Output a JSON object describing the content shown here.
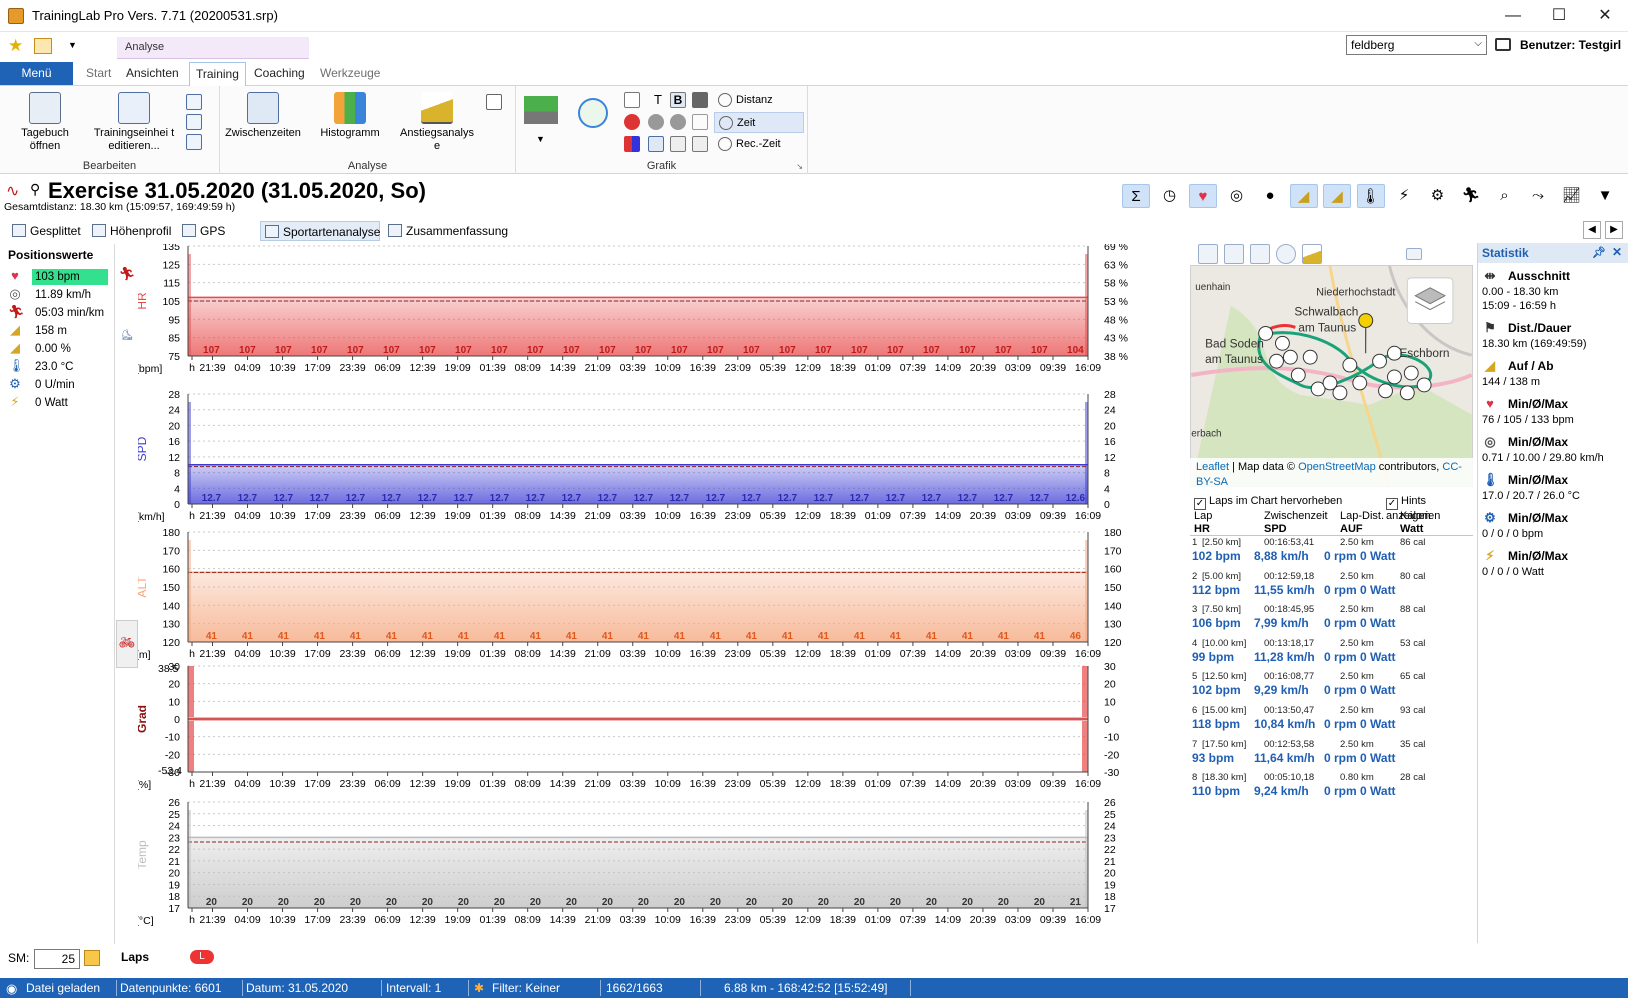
{
  "window": {
    "title": "TrainingLab Pro Vers. 7.71 (20200531.srp)",
    "min": "—",
    "max": "☐",
    "close": "✕"
  },
  "context_tab": "Analyse",
  "user": {
    "selected": "feldberg",
    "label": "Benutzer: Testgirl"
  },
  "tabs": [
    "Menü",
    "Start",
    "Ansichten",
    "Training",
    "Coaching",
    "Werkzeuge"
  ],
  "ribbon": {
    "bearbeiten": {
      "label": "Bearbeiten",
      "tagebuch": "Tagebuch öffnen",
      "trainingseinheit": "Trainingseinhei t editieren..."
    },
    "analyse": {
      "label": "Analyse",
      "zwischenzeiten": "Zwischenzeiten",
      "histogramm": "Histogramm",
      "anstieg": "Anstiegsanalys e"
    },
    "grafik": {
      "label": "Grafik",
      "distanz": "Distanz",
      "zeit": "Zeit",
      "reczeit": "Rec.-Zeit",
      "t_glyph": "T",
      "b_glyph": "B"
    }
  },
  "exercise": {
    "title": "Exercise 31.05.2020 (31.05.2020, So)",
    "subtitle": "Gesamtdistanz: 18.30 km (15:09:57, 169:49:59 h)"
  },
  "view_tabs": [
    "Gesplittet",
    "Höhenprofil",
    "GPS Karte",
    "Sportartenanalyse",
    "Zusammenfassung"
  ],
  "position_values": {
    "header": "Positionswerte",
    "items": [
      {
        "icon": "heart-icon",
        "text": "103 bpm"
      },
      {
        "icon": "speedometer-icon",
        "text": "11.89 km/h"
      },
      {
        "icon": "runner-icon",
        "text": "05:03 min/km"
      },
      {
        "icon": "mountain-icon",
        "text": "158 m"
      },
      {
        "icon": "slope-icon",
        "text": "0.00 %"
      },
      {
        "icon": "thermometer-icon",
        "text": "23.0 °C"
      },
      {
        "icon": "cadence-icon",
        "text": "0 U/min"
      },
      {
        "icon": "power-icon",
        "text": "0 Watt"
      }
    ]
  },
  "sm": {
    "label": "SM:",
    "value": "25"
  },
  "laps_label": "Laps",
  "x_ticks": [
    "h",
    "21:39",
    "04:09",
    "10:39",
    "17:09",
    "23:39",
    "06:09",
    "12:39",
    "19:09",
    "01:39",
    "08:09",
    "14:39",
    "21:09",
    "03:39",
    "10:09",
    "16:39",
    "23:09",
    "05:39",
    "12:09",
    "18:39",
    "01:09",
    "07:39",
    "14:09",
    "20:39",
    "03:09",
    "09:39",
    "16:09"
  ],
  "chart_data": [
    {
      "type": "area",
      "name": "HR",
      "ylabel": "HR",
      "unit": "[bpm]",
      "color": "#e84a4a",
      "y_ticks": [
        135,
        125,
        115,
        105,
        95,
        85,
        75
      ],
      "ylim": [
        75,
        135
      ],
      "right_ticks": [
        "69 %",
        "63 %",
        "58 %",
        "53 %",
        "48 %",
        "43 %",
        "38 %"
      ],
      "labels": [
        "107",
        "107",
        "107",
        "107",
        "107",
        "107",
        "107",
        "107",
        "107",
        "107",
        "107",
        "107",
        "107",
        "107",
        "107",
        "107",
        "107",
        "107",
        "107",
        "107",
        "107",
        "107",
        "107",
        "107",
        "104"
      ],
      "value": 107,
      "avg": 105
    },
    {
      "type": "area",
      "name": "SPD",
      "ylabel": "SPD",
      "unit": "[km/h]",
      "color": "#3b3bd6",
      "y_ticks": [
        28,
        24,
        20,
        16,
        12,
        8,
        4,
        0
      ],
      "ylim": [
        0,
        28
      ],
      "right_ticks": [
        "28",
        "24",
        "20",
        "16",
        "12",
        "8",
        "4",
        "0"
      ],
      "labels": [
        "12.7",
        "12.7",
        "12.7",
        "12.7",
        "12.7",
        "12.7",
        "12.7",
        "12.7",
        "12.7",
        "12.7",
        "12.7",
        "12.7",
        "12.7",
        "12.7",
        "12.7",
        "12.7",
        "12.7",
        "12.7",
        "12.7",
        "12.7",
        "12.7",
        "12.7",
        "12.7",
        "12.7",
        "12.6"
      ],
      "value": 10,
      "avg": 9.5
    },
    {
      "type": "area",
      "name": "ALT",
      "ylabel": "ALT",
      "unit": "[m]",
      "color": "#f5a47a",
      "y_ticks": [
        180,
        170,
        160,
        150,
        140,
        130,
        120
      ],
      "ylim": [
        120,
        180
      ],
      "right_ticks": [
        "180",
        "170",
        "160",
        "150",
        "140",
        "130",
        "120"
      ],
      "labels": [
        "41",
        "41",
        "41",
        "41",
        "41",
        "41",
        "41",
        "41",
        "41",
        "41",
        "41",
        "41",
        "41",
        "41",
        "41",
        "41",
        "41",
        "41",
        "41",
        "41",
        "41",
        "41",
        "41",
        "41",
        "46"
      ],
      "value": 158,
      "avg": 158
    },
    {
      "type": "line",
      "name": "Grad",
      "ylabel": "Grad",
      "unit": "[%]",
      "color": "#c21a1a",
      "y_ticks": [
        30,
        20,
        10,
        0,
        -10,
        -20,
        -30
      ],
      "ylim": [
        -30,
        30
      ],
      "right_ticks": [
        "30",
        "20",
        "10",
        "0",
        "-10",
        "-20",
        "-30"
      ],
      "extra_top": "38.5",
      "extra_bottom": "-52.4",
      "labels": [],
      "value": 0,
      "avg": 0
    },
    {
      "type": "area",
      "name": "Temp",
      "ylabel": "Temp",
      "unit": "[°C]",
      "color": "#bdbdbd",
      "y_ticks": [
        26,
        25,
        24,
        23,
        22,
        21,
        20,
        19,
        18,
        17
      ],
      "ylim": [
        17,
        26
      ],
      "right_ticks": [
        "26",
        "25",
        "24",
        "23",
        "22",
        "21",
        "20",
        "19",
        "18",
        "17"
      ],
      "labels": [
        "20",
        "20",
        "20",
        "20",
        "20",
        "20",
        "20",
        "20",
        "20",
        "20",
        "20",
        "20",
        "20",
        "20",
        "20",
        "20",
        "20",
        "20",
        "20",
        "20",
        "20",
        "20",
        "20",
        "20",
        "21"
      ],
      "value": 23,
      "avg": 22.6
    }
  ],
  "map": {
    "labels": [
      "uenhain",
      "Niederhochstadt",
      "Schwalbach am Taunus",
      "Bad Soden am Taunus",
      "Eschborn",
      "erbach"
    ],
    "attribution": {
      "leaflet": "Leaflet",
      "mid": " | Map data © ",
      "osm": "OpenStreetMap",
      "end": " contributors, ",
      "cc": "CC-BY-SA"
    }
  },
  "checks": {
    "laps": "Laps im Chart hervorheben",
    "hints": "Hints anzeigen"
  },
  "laps_table": {
    "headers": [
      [
        "Lap",
        "HR"
      ],
      [
        "Zwischenzeit",
        "SPD"
      ],
      [
        "Lap-Dist.",
        "AUF"
      ],
      [
        "Kalorien",
        "Watt"
      ]
    ],
    "rows": [
      {
        "lap": "1",
        "km": "[2.50 km]",
        "zeit": "00:16:53,41",
        "dist": "2.50 km",
        "cal": "86 cal",
        "hr": "102 bpm",
        "spd": "8,88 km/h",
        "auf": "0 rpm",
        "watt": "0 Watt"
      },
      {
        "lap": "2",
        "km": "[5.00 km]",
        "zeit": "00:12:59,18",
        "dist": "2.50 km",
        "cal": "80 cal",
        "hr": "112 bpm",
        "spd": "11,55 km/h",
        "auf": "0 rpm",
        "watt": "0 Watt"
      },
      {
        "lap": "3",
        "km": "[7.50 km]",
        "zeit": "00:18:45,95",
        "dist": "2.50 km",
        "cal": "88 cal",
        "hr": "106 bpm",
        "spd": "7,99 km/h",
        "auf": "0 rpm",
        "watt": "0 Watt"
      },
      {
        "lap": "4",
        "km": "[10.00 km]",
        "zeit": "00:13:18,17",
        "dist": "2.50 km",
        "cal": "53 cal",
        "hr": "99 bpm",
        "spd": "11,28 km/h",
        "auf": "0 rpm",
        "watt": "0 Watt"
      },
      {
        "lap": "5",
        "km": "[12.50 km]",
        "zeit": "00:16:08,77",
        "dist": "2.50 km",
        "cal": "65 cal",
        "hr": "102 bpm",
        "spd": "9,29 km/h",
        "auf": "0 rpm",
        "watt": "0 Watt"
      },
      {
        "lap": "6",
        "km": "[15.00 km]",
        "zeit": "00:13:50,47",
        "dist": "2.50 km",
        "cal": "93 cal",
        "hr": "118 bpm",
        "spd": "10,84 km/h",
        "auf": "0 rpm",
        "watt": "0 Watt"
      },
      {
        "lap": "7",
        "km": "[17.50 km]",
        "zeit": "00:12:53,58",
        "dist": "2.50 km",
        "cal": "35 cal",
        "hr": "93 bpm",
        "spd": "11,64 km/h",
        "auf": "0 rpm",
        "watt": "0 Watt"
      },
      {
        "lap": "8",
        "km": "[18.30 km]",
        "zeit": "00:05:10,18",
        "dist": "0.80 km",
        "cal": "28 cal",
        "hr": "110 bpm",
        "spd": "9,24 km/h",
        "auf": "0 rpm",
        "watt": "0 Watt"
      }
    ]
  },
  "statistik": {
    "header": "Statistik",
    "items": [
      {
        "icon": "section-icon",
        "title": "Ausschnitt",
        "lines": [
          "0.00 - 18.30 km",
          "15:09 - 16:59 h"
        ]
      },
      {
        "icon": "flag-icon",
        "title": "Dist./Dauer",
        "lines": [
          "18.30 km (169:49:59)"
        ]
      },
      {
        "icon": "mountain-icon",
        "title": "Auf / Ab",
        "lines": [
          "144 / 138 m"
        ]
      },
      {
        "icon": "heart-icon",
        "title": "Min/Ø/Max",
        "lines": [
          "76 / 105 / 133 bpm"
        ]
      },
      {
        "icon": "speedometer-icon",
        "title": "Min/Ø/Max",
        "lines": [
          "0.71 / 10.00 / 29.80 km/h"
        ]
      },
      {
        "icon": "thermometer-icon",
        "title": "Min/Ø/Max",
        "lines": [
          "17.0 / 20.7 / 26.0 °C"
        ]
      },
      {
        "icon": "cadence-icon",
        "title": "Min/Ø/Max",
        "lines": [
          "0 / 0 / 0 bpm"
        ]
      },
      {
        "icon": "power-icon",
        "title": "Min/Ø/Max",
        "lines": [
          "0 / 0 / 0 Watt"
        ]
      }
    ]
  },
  "status": {
    "loaded": "Datei geladen",
    "points": "Datenpunkte: 6601",
    "date": "Datum: 31.05.2020",
    "interval": "Intervall: 1",
    "filter": "Filter: Keiner",
    "pos": "1662/1663",
    "info": "6.88 km - 168:42:52 [15:52:49]"
  }
}
